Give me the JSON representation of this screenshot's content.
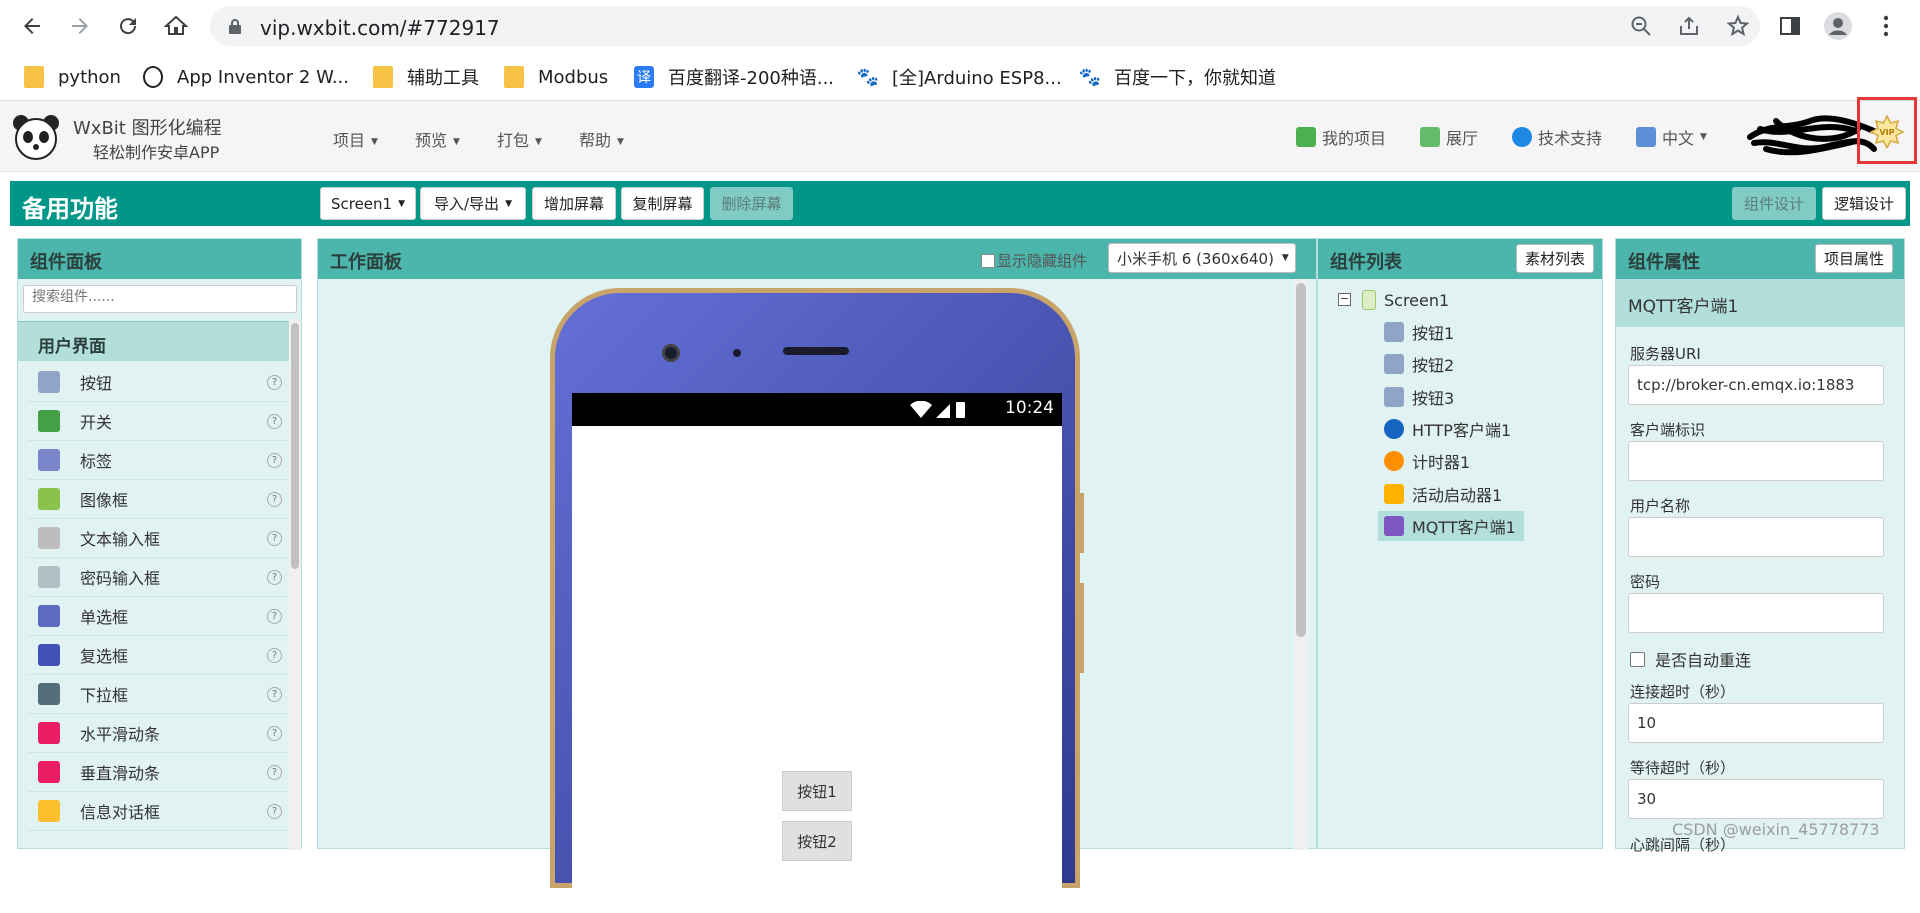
{
  "browser": {
    "url": "vip.wxbit.com/#772917",
    "bookmarks": [
      {
        "label": "python",
        "icon": "folder-icon"
      },
      {
        "label": "App Inventor 2 W...",
        "icon": "panda-icon"
      },
      {
        "label": "辅助工具",
        "icon": "folder-icon"
      },
      {
        "label": "Modbus",
        "icon": "folder-icon"
      },
      {
        "label": "百度翻译-200种语...",
        "icon": "translate-icon"
      },
      {
        "label": "[全]Arduino ESP8...",
        "icon": "baidu-icon"
      },
      {
        "label": "百度一下，你就知道",
        "icon": "baidu-icon"
      }
    ]
  },
  "app": {
    "title": "WxBit 图形化编程",
    "subtitle": "轻松制作安卓APP",
    "menus": [
      "项目",
      "预览",
      "打包",
      "帮助"
    ],
    "right_nav": [
      {
        "label": "我的项目",
        "icon": "list-icon"
      },
      {
        "label": "展厅",
        "icon": "grid-icon"
      },
      {
        "label": "技术支持",
        "icon": "support-icon"
      },
      {
        "label": "中文",
        "icon": "language-icon"
      }
    ],
    "vip_label": "VIP"
  },
  "toolbar": {
    "title": "备用功能",
    "screen_select": "Screen1",
    "import_export": "导入/导出",
    "add_screen": "增加屏幕",
    "copy_screen": "复制屏幕",
    "delete_screen": "删除屏幕",
    "component_design": "组件设计",
    "logic_design": "逻辑设计"
  },
  "palette": {
    "title": "组件面板",
    "search_placeholder": "搜索组件......",
    "category": "用户界面",
    "items": [
      {
        "label": "按钮",
        "icon": "button-icon"
      },
      {
        "label": "开关",
        "icon": "switch-icon"
      },
      {
        "label": "标签",
        "icon": "label-icon"
      },
      {
        "label": "图像框",
        "icon": "image-icon"
      },
      {
        "label": "文本输入框",
        "icon": "textbox-icon"
      },
      {
        "label": "密码输入框",
        "icon": "password-icon"
      },
      {
        "label": "单选框",
        "icon": "radio-icon"
      },
      {
        "label": "复选框",
        "icon": "checkbox-icon"
      },
      {
        "label": "下拉框",
        "icon": "spinner-icon"
      },
      {
        "label": "水平滑动条",
        "icon": "hslider-icon"
      },
      {
        "label": "垂直滑动条",
        "icon": "vslider-icon"
      },
      {
        "label": "信息对话框",
        "icon": "notifier-icon"
      }
    ],
    "help_glyph": "?"
  },
  "viewer": {
    "title": "工作面板",
    "show_hidden_label": "显示隐藏组件",
    "device": "小米手机 6 (360x640)",
    "clock": "10:24",
    "buttons": [
      "按钮1",
      "按钮2"
    ]
  },
  "tree": {
    "title": "组件列表",
    "assets_button": "素材列表",
    "root": "Screen1",
    "items": [
      {
        "label": "按钮1",
        "icon": "button-icon"
      },
      {
        "label": "按钮2",
        "icon": "button-icon"
      },
      {
        "label": "按钮3",
        "icon": "button-icon"
      },
      {
        "label": "HTTP客户端1",
        "icon": "globe-icon"
      },
      {
        "label": "计时器1",
        "icon": "clock-icon"
      },
      {
        "label": "活动启动器1",
        "icon": "bolt-icon"
      },
      {
        "label": "MQTT客户端1",
        "icon": "mqtt-icon",
        "selected": true
      }
    ]
  },
  "properties": {
    "title": "组件属性",
    "project_props": "项目属性",
    "component_name": "MQTT客户端1",
    "server_uri_label": "服务器URI",
    "server_uri": "tcp://broker-cn.emqx.io:1883",
    "client_id_label": "客户端标识",
    "client_id": "",
    "username_label": "用户名称",
    "username": "",
    "password_label": "密码",
    "password": "",
    "auto_reconnect_label": "是否自动重连",
    "connect_timeout_label": "连接超时（秒）",
    "connect_timeout": "10",
    "wait_timeout_label": "等待超时（秒）",
    "wait_timeout": "30",
    "keepalive_label": "心跳间隔（秒）"
  },
  "watermark": "CSDN @weixin_45778773",
  "colors": {
    "accent": "#009688",
    "panel_head": "#4db6ac",
    "panel_bg": "#e0f2f1"
  }
}
